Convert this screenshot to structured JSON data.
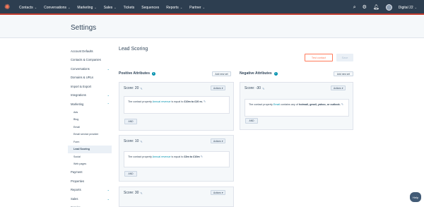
{
  "nav": {
    "items": [
      {
        "label": "Contacts",
        "caret": true
      },
      {
        "label": "Conversations",
        "caret": true
      },
      {
        "label": "Marketing",
        "caret": true
      },
      {
        "label": "Sales",
        "caret": true
      },
      {
        "label": "Tickets",
        "caret": false
      },
      {
        "label": "Sequences",
        "caret": false
      },
      {
        "label": "Reports",
        "caret": true
      },
      {
        "label": "Partner",
        "caret": true
      }
    ],
    "account": "Digital 22",
    "caret_glyph": "⌄"
  },
  "header": {
    "title": "Settings"
  },
  "sidebar": {
    "items": [
      {
        "label": "Account Defaults"
      },
      {
        "label": "Contacts & Companies"
      },
      {
        "label": "Conversations",
        "chev": "⌄"
      },
      {
        "label": "Domains & URLs"
      },
      {
        "label": "Import & Export"
      },
      {
        "label": "Integrations",
        "chev": "⌄"
      },
      {
        "label": "Marketing",
        "chev": "⌃"
      }
    ],
    "subitems": [
      "Ads",
      "Blog",
      "Email",
      "Email service provider",
      "Form",
      "Lead Scoring",
      "Social",
      "Web pages"
    ],
    "items_after": [
      {
        "label": "Payment"
      },
      {
        "label": "Properties"
      },
      {
        "label": "Reports",
        "chev": "⌄"
      },
      {
        "label": "Sales",
        "chev": "⌄"
      },
      {
        "label": "Service",
        "chev": "⌄"
      }
    ]
  },
  "main": {
    "title": "Lead Scoring",
    "test_contact_label": "Test contact",
    "save_label": "Save",
    "positive": {
      "title": "Positive Attributes",
      "add_new_set": "Add new set",
      "cards": [
        {
          "score": "Score: 20",
          "actions": "Actions",
          "rule_pre": "The contact property ",
          "rule_prop": "Annual revenue",
          "rule_mid": " is equal to ",
          "rule_val": "£10m to £20 m.",
          "and": "AND"
        },
        {
          "score": "Score: 10",
          "actions": "Actions",
          "rule_pre": "The contact property ",
          "rule_prop": "Annual revenue",
          "rule_mid": " is equal to ",
          "rule_val": "£3m to £10m",
          "and": "AND"
        },
        {
          "score": "Score: 30",
          "actions": "Actions"
        }
      ]
    },
    "negative": {
      "title": "Negative Attributes",
      "add_new_set": "Add new set",
      "cards": [
        {
          "score": "Score: -30",
          "actions": "Actions",
          "rule_pre": "The contact property ",
          "rule_prop": "Email",
          "rule_mid": " contains any of ",
          "rule_val": "hotmail, gmail, yahoo, or outlook.",
          "and": "AND"
        }
      ]
    }
  },
  "help_label": "Help",
  "colors": {
    "nav_bg": "#2d3e50",
    "accent": "#ff7a59",
    "link": "#0091ae",
    "panel": "#f5f8fa"
  }
}
